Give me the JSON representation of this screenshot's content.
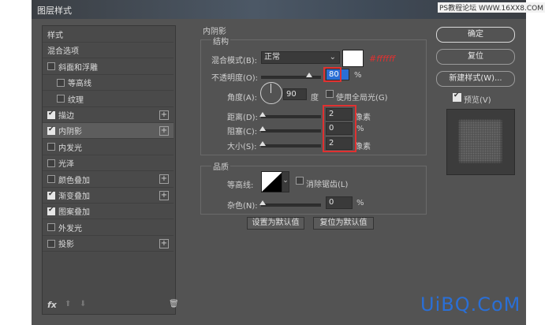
{
  "window": {
    "title": "图层样式",
    "watermark_top": "PS教程论坛 WWW.16XX8.COM",
    "watermark_bottom": "UiBQ.CoM"
  },
  "sidebar": {
    "items": [
      {
        "label": "样式",
        "checkbox": false,
        "checked": false,
        "plus": false,
        "active": false
      },
      {
        "label": "混合选项",
        "checkbox": false,
        "checked": false,
        "plus": false,
        "active": false
      },
      {
        "label": "斜面和浮雕",
        "checkbox": true,
        "checked": false,
        "plus": false,
        "active": false
      },
      {
        "label": "等高线",
        "checkbox": true,
        "checked": false,
        "plus": false,
        "active": false
      },
      {
        "label": "纹理",
        "checkbox": true,
        "checked": false,
        "plus": false,
        "active": false
      },
      {
        "label": "描边",
        "checkbox": true,
        "checked": true,
        "plus": true,
        "active": false
      },
      {
        "label": "内阴影",
        "checkbox": true,
        "checked": true,
        "plus": true,
        "active": true
      },
      {
        "label": "内发光",
        "checkbox": true,
        "checked": false,
        "plus": false,
        "active": false
      },
      {
        "label": "光泽",
        "checkbox": true,
        "checked": false,
        "plus": false,
        "active": false
      },
      {
        "label": "颜色叠加",
        "checkbox": true,
        "checked": false,
        "plus": true,
        "active": false
      },
      {
        "label": "渐变叠加",
        "checkbox": true,
        "checked": true,
        "plus": true,
        "active": false
      },
      {
        "label": "图案叠加",
        "checkbox": true,
        "checked": true,
        "plus": false,
        "active": false
      },
      {
        "label": "外发光",
        "checkbox": true,
        "checked": false,
        "plus": false,
        "active": false
      },
      {
        "label": "投影",
        "checkbox": true,
        "checked": false,
        "plus": true,
        "active": false
      }
    ],
    "footer": {
      "fx_label": "fx"
    }
  },
  "inner_shadow": {
    "section_title": "内阴影",
    "structure_title": "结构",
    "blend_mode_label": "混合模式(B):",
    "blend_mode_value": "正常",
    "color_annotation": "#ffffff",
    "opacity_label": "不透明度(O):",
    "opacity_value": "80",
    "opacity_unit": "%",
    "opacity_level": 0.8,
    "angle_label": "角度(A):",
    "angle_value": "90",
    "angle_unit": "度",
    "global_light_label": "使用全局光(G)",
    "distance_label": "距离(D):",
    "distance_value": "2",
    "distance_unit": "像素",
    "choke_label": "阻塞(C):",
    "choke_value": "0",
    "choke_unit": "%",
    "size_label": "大小(S):",
    "size_value": "2",
    "size_unit": "像素",
    "quality_title": "品质",
    "contour_label": "等高线:",
    "antialias_label": "消除锯齿(L)",
    "noise_label": "杂色(N):",
    "noise_value": "0",
    "noise_unit": "%",
    "set_default_label": "设置为默认值",
    "reset_default_label": "复位为默认值"
  },
  "right": {
    "ok_label": "确定",
    "reset_label": "复位",
    "new_style_label": "新建样式(W)...",
    "preview_label": "预览(V)",
    "preview_checked": true
  },
  "colors": {
    "annotation_red": "#e03131",
    "dialog_bg": "#535353",
    "watermark_blue": "#2a6fd6"
  }
}
